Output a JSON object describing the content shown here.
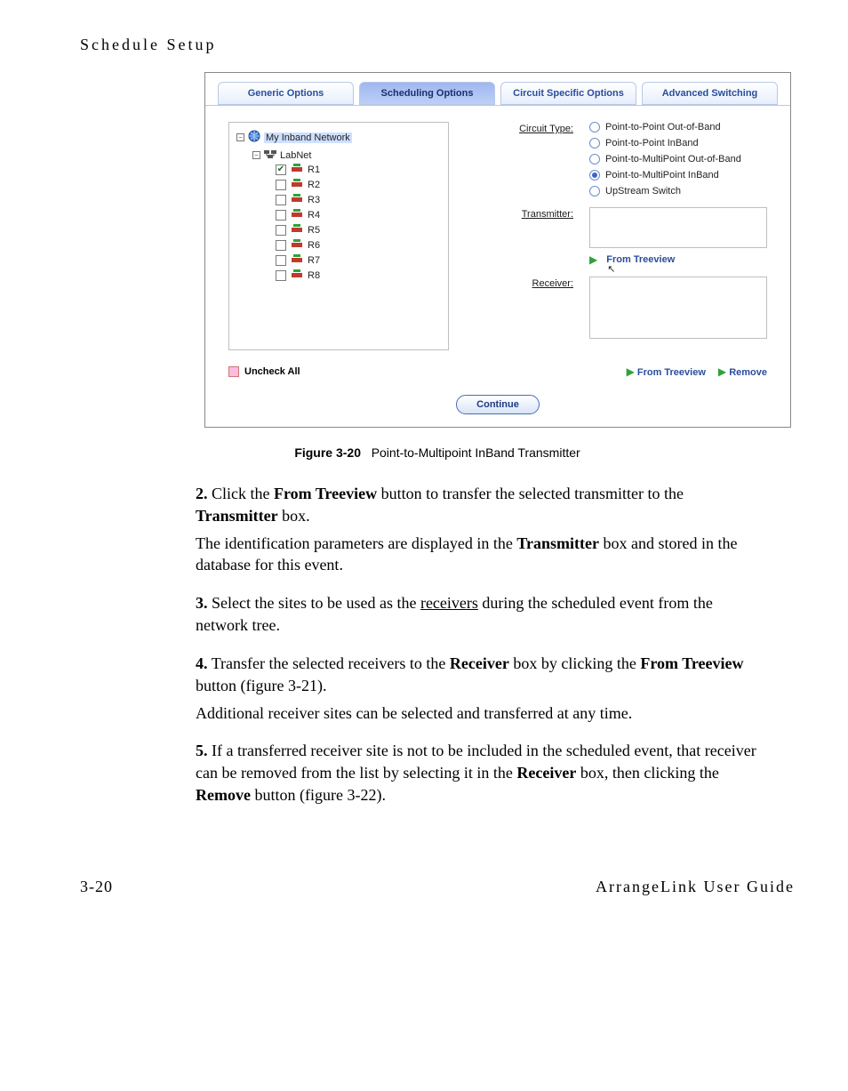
{
  "page": {
    "header": "Schedule Setup",
    "footer_left": "3-20",
    "footer_right": "ArrangeLink User Guide"
  },
  "figure": {
    "tabs": {
      "generic": "Generic Options",
      "scheduling": "Scheduling Options",
      "circuit": "Circuit Specific Options",
      "advanced": "Advanced Switching"
    },
    "tree": {
      "root": "My Inband Network",
      "subnet": "LabNet",
      "items": [
        {
          "label": "R1",
          "checked": true
        },
        {
          "label": "R2",
          "checked": false
        },
        {
          "label": "R3",
          "checked": false
        },
        {
          "label": "R4",
          "checked": false
        },
        {
          "label": "R5",
          "checked": false
        },
        {
          "label": "R6",
          "checked": false
        },
        {
          "label": "R7",
          "checked": false
        },
        {
          "label": "R8",
          "checked": false
        }
      ]
    },
    "circuit_type_label": "Circuit Type:",
    "circuit_types": {
      "pp_oob": "Point-to-Point Out-of-Band",
      "pp_ib": "Point-to-Point InBand",
      "pmp_oob": "Point-to-MultiPoint Out-of-Band",
      "pmp_ib": "Point-to-MultiPoint InBand",
      "upstream": "UpStream Switch"
    },
    "transmitter_label": "Transmitter:",
    "receiver_label": "Receiver:",
    "from_treeview": "From Treeview",
    "remove": "Remove",
    "uncheck_all": "Uncheck All",
    "continue": "Continue"
  },
  "caption": {
    "label": "Figure 3-20",
    "text": "Point-to-Multipoint InBand Transmitter"
  },
  "steps": {
    "s2a": "Click the ",
    "s2b": "From Treeview",
    "s2c": " button to transfer the selected transmitter to the ",
    "s2d": "Transmitter",
    "s2e": " box.",
    "s2p": "The identification parameters are displayed in the ",
    "s2p2": "Transmitter",
    "s2p3": " box and stored in the database for this event.",
    "s3a": "Select the sites to be used as the ",
    "s3b": "receivers",
    "s3c": " during the scheduled event from the network tree.",
    "s4a": "Transfer the selected receivers to the ",
    "s4b": "Receiver",
    "s4c": " box by clicking the ",
    "s4d": "From Treeview",
    "s4e": " button (figure 3-21).",
    "s4p": "Additional receiver sites can be selected and transferred at any time.",
    "s5a": "If a transferred receiver site is not to be included in the scheduled event, that receiver can be removed from the list by selecting it in the ",
    "s5b": "Receiver",
    "s5c": " box, then clicking the ",
    "s5d": "Remove",
    "s5e": " button (figure 3-22)."
  }
}
